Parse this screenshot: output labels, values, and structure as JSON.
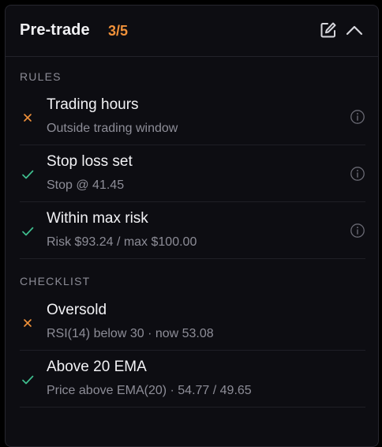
{
  "header": {
    "title": "Pre-trade",
    "count": "3/5",
    "edit_icon": "edit-icon",
    "collapse_icon": "chevron-up-icon"
  },
  "colors": {
    "pass": "#3fbf8f",
    "fail": "#f0913a",
    "accent_count": "#f0913a"
  },
  "rules": {
    "label": "RULES",
    "items": [
      {
        "name": "Trading hours",
        "detail": "Outside trading window",
        "status": "fail",
        "info_icon": "info-icon"
      },
      {
        "name": "Stop loss set",
        "detail": "Stop @ 41.45",
        "status": "pass",
        "info_icon": "info-icon"
      },
      {
        "name": "Within max risk",
        "detail": "Risk $93.24 / max $100.00",
        "status": "pass",
        "info_icon": "info-icon"
      }
    ]
  },
  "checklist": {
    "label": "CHECKLIST",
    "items": [
      {
        "name": "Oversold",
        "detail": "RSI(14) below 30 · now 53.08",
        "status": "fail"
      },
      {
        "name": "Above 20 EMA",
        "detail": "Price above EMA(20) · 54.77 / 49.65",
        "status": "pass"
      }
    ]
  }
}
